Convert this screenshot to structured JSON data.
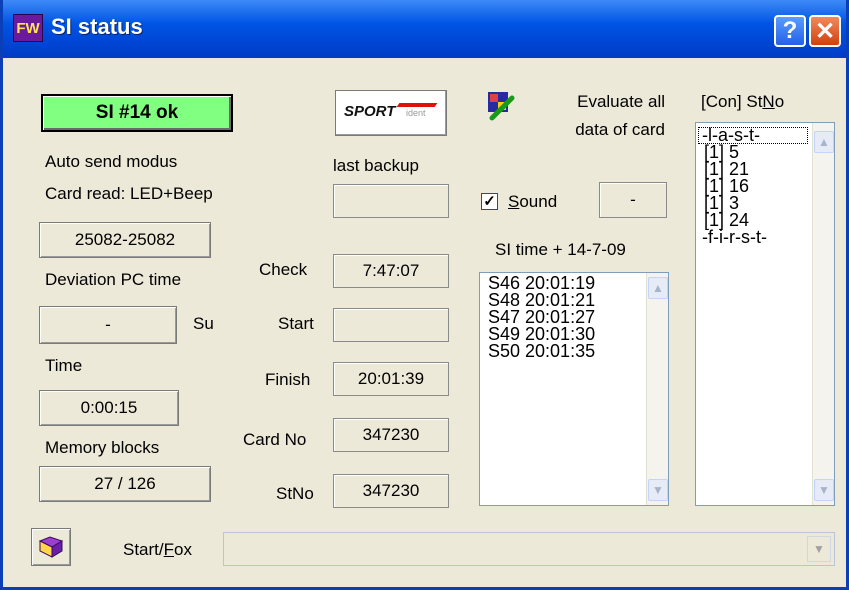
{
  "window": {
    "title": "SI status",
    "icon_text": "FW",
    "help_glyph": "?",
    "close_glyph": "✕"
  },
  "left": {
    "status": "SI #14 ok",
    "auto_send": "Auto send modus",
    "card_read": "Card read: LED+Beep",
    "range": "25082-25082",
    "deviation_label": "Deviation PC time",
    "deviation_value": "-",
    "deviation_unit": "Su",
    "time_label": "Time",
    "time_value": "0:00:15",
    "memory_label": "Memory blocks",
    "memory_value": "27 / 126"
  },
  "middle": {
    "last_backup_label": "last backup",
    "last_backup_value": "",
    "check_label": "Check",
    "check_value": "7:47:07",
    "start_label": "Start",
    "start_value": "",
    "finish_label": "Finish",
    "finish_value": "20:01:39",
    "cardno_label": "Card No",
    "cardno_value": "347230",
    "stno_label": "StNo",
    "stno_value": "347230"
  },
  "evaluate": {
    "line1": "Evaluate all",
    "line2": "data of card"
  },
  "sound": {
    "checked": true,
    "label_pre": "",
    "label_u": "S",
    "label_post": "ound",
    "value": "-"
  },
  "si_time": {
    "header": "SI time + 14-7-09",
    "rows": [
      "S46  20:01:19",
      "S48  20:01:21",
      "S47  20:01:27",
      "S49  20:01:30",
      "S50  20:01:35"
    ]
  },
  "con": {
    "header_pre": "[Con]  St",
    "header_u": "N",
    "header_post": "o",
    "rows": [
      "-l-a-s-t-",
      " [1]  5",
      " [1]  21",
      " [1]  16",
      " [1]  3",
      " [1]  24",
      "-f-i-r-s-t-"
    ]
  },
  "bottom": {
    "label_pre": "Start/",
    "label_u": "F",
    "label_post": "ox",
    "combo_value": ""
  }
}
